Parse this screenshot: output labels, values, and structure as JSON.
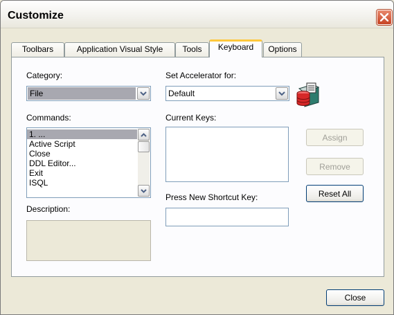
{
  "window": {
    "title": "Customize"
  },
  "tabs": [
    {
      "label": "Toolbars",
      "active": false
    },
    {
      "label": "Application Visual Style",
      "active": false
    },
    {
      "label": "Tools",
      "active": false
    },
    {
      "label": "Keyboard",
      "active": true
    },
    {
      "label": "Options",
      "active": false
    }
  ],
  "category": {
    "label": "Category:",
    "value": "File"
  },
  "accelerator": {
    "label": "Set Accelerator for:",
    "value": "Default"
  },
  "commands": {
    "label": "Commands:",
    "items": [
      "1. ...",
      "Active Script",
      "Close",
      "DDL Editor...",
      "Exit",
      "ISQL"
    ],
    "selected_index": 0
  },
  "current_keys": {
    "label": "Current Keys:"
  },
  "shortcut": {
    "label": "Press New Shortcut Key:",
    "value": ""
  },
  "description": {
    "label": "Description:"
  },
  "buttons": {
    "assign": "Assign",
    "remove": "Remove",
    "reset_all": "Reset All",
    "close": "Close"
  },
  "colors": {
    "accent_tab": "#ffc83c",
    "close_x": "#c64223",
    "panel": "#fcfcfe",
    "face": "#ece9d8"
  }
}
